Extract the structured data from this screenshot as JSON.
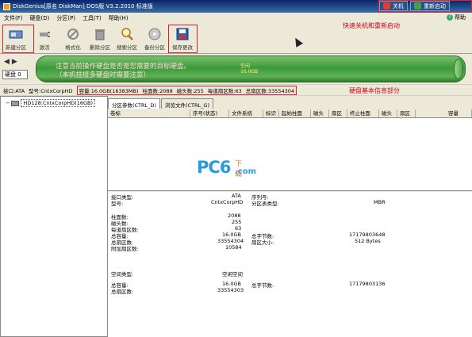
{
  "window": {
    "title": "DiskGenius[原名 DiskMan] DOS版 V3.2.2010 标准版",
    "shutdown_label": "关机",
    "restart_label": "重新启动"
  },
  "menu": [
    "文件(F)",
    "硬盘(D)",
    "分区(P)",
    "工具(T)",
    "帮助(H)"
  ],
  "help_label": "帮助",
  "annotations": {
    "quick": "快速关机和重新启动",
    "disk_info": "硬盘基本信息部分"
  },
  "toolbar": [
    {
      "label": "新建分区",
      "icon": "new-partition-icon"
    },
    {
      "label": "激活",
      "icon": "activate-icon"
    },
    {
      "label": "格式化",
      "icon": "format-icon"
    },
    {
      "label": "删除分区",
      "icon": "delete-partition-icon"
    },
    {
      "label": "搜索分区",
      "icon": "search-partition-icon"
    },
    {
      "label": "备份分区",
      "icon": "backup-partition-icon"
    },
    {
      "label": "保存更改",
      "icon": "save-changes-icon"
    }
  ],
  "disk": {
    "label": "硬盘 0",
    "notice_line1": "注意当前操作硬盘是否是您需要的目标硬盘。",
    "notice_line2": "（本机挂接多硬盘时需要注意）",
    "idle_line1": "空闲",
    "idle_line2": "16.0GB"
  },
  "infobar": {
    "interface": "接口:ATA",
    "model": "型号:CntxCorpHD",
    "capacity": "容量:16.0GB(16383MB)",
    "cylinders": "柱面数:2088",
    "heads": "磁头数:255",
    "sectors_per_track": "每道扇区数:63",
    "total_sectors": "总扇区数:33554304"
  },
  "tree": {
    "item": "HD128:CntxCorpHD(16GB)"
  },
  "tabs": [
    "分区参数(CTRL_D)",
    "浏览文件(CTRL_G)"
  ],
  "columns": [
    "卷标",
    "序号(状态)",
    "文件系统",
    "标识",
    "起始柱面",
    "磁头",
    "扇区",
    "终止柱面",
    "磁头",
    "扇区",
    "容量"
  ],
  "details": {
    "iface_label": "接口类型:",
    "iface_value": "ATA",
    "model_label": "型号:",
    "model_value": "CntxCorpHD",
    "serial_label": "序列号:",
    "ptable_label": "分区表类型:",
    "ptable_value": "MBR",
    "cyl_label": "柱面数:",
    "cyl_value": "2088",
    "heads_label": "磁头数:",
    "heads_value": "255",
    "spt_label": "每道扇区数:",
    "spt_value": "63",
    "cap_label": "总容量:",
    "cap_value": "16.0GB",
    "bytes_label": "总字节数:",
    "bytes_value": "17179803648",
    "tsec_label": "总扇区数:",
    "tsec_value": "33554304",
    "secsize_label": "扇区大小:",
    "secsize_value": "512 Bytes",
    "extra_label": "附加扇区数:",
    "extra_value": "10584",
    "space_label": "空间类型:",
    "space_value": "空闲空间",
    "scap_label": "总容量:",
    "scap_value": "16.0GB",
    "sbytes_label": "总字节数:",
    "sbytes_value": "17179803136",
    "ssec_label": "总扇区数:",
    "ssec_value": "33554303"
  },
  "watermark": {
    "pc": "PC",
    "six": "6",
    "xz": "下载",
    "com": ".com"
  }
}
